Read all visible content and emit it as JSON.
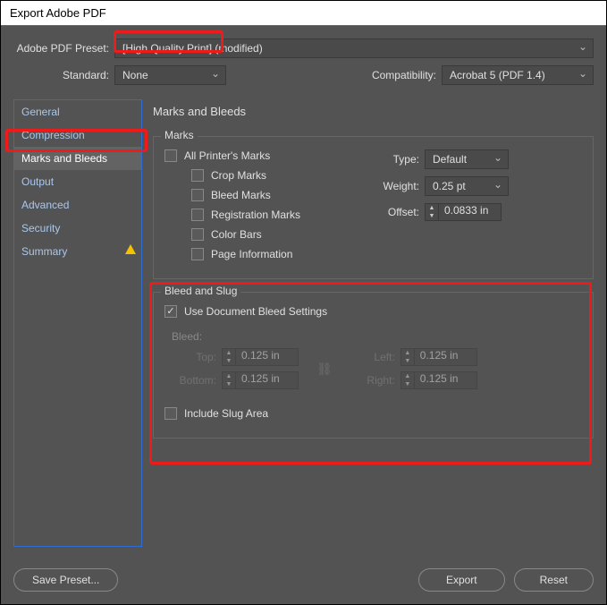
{
  "window": {
    "title": "Export Adobe PDF"
  },
  "top": {
    "presetLabel": "Adobe PDF Preset:",
    "presetValue": "[High Quality Print] (modified)",
    "standardLabel": "Standard:",
    "standardValue": "None",
    "compatLabel": "Compatibility:",
    "compatValue": "Acrobat 5 (PDF 1.4)"
  },
  "sidebar": {
    "items": [
      {
        "label": "General"
      },
      {
        "label": "Compression"
      },
      {
        "label": "Marks and Bleeds"
      },
      {
        "label": "Output"
      },
      {
        "label": "Advanced"
      },
      {
        "label": "Security"
      },
      {
        "label": "Summary"
      }
    ]
  },
  "panel": {
    "title": "Marks and Bleeds",
    "marksLegend": "Marks",
    "allPrinters": "All Printer's Marks",
    "crop": "Crop Marks",
    "bleedMarks": "Bleed Marks",
    "registration": "Registration Marks",
    "colorBars": "Color Bars",
    "pageInfo": "Page Information",
    "typeLabel": "Type:",
    "typeValue": "Default",
    "weightLabel": "Weight:",
    "weightValue": "0.25 pt",
    "offsetLabel": "Offset:",
    "offsetValue": "0.0833 in",
    "bleedLegend": "Bleed and Slug",
    "useDoc": "Use Document Bleed Settings",
    "bleedLabel": "Bleed:",
    "topLabel": "Top:",
    "bottomLabel": "Bottom:",
    "leftLabel": "Left:",
    "rightLabel": "Right:",
    "bleedTop": "0.125 in",
    "bleedBottom": "0.125 in",
    "bleedLeft": "0.125 in",
    "bleedRight": "0.125 in",
    "includeSlug": "Include Slug Area"
  },
  "footer": {
    "savePreset": "Save Preset...",
    "export": "Export",
    "reset": "Reset"
  }
}
